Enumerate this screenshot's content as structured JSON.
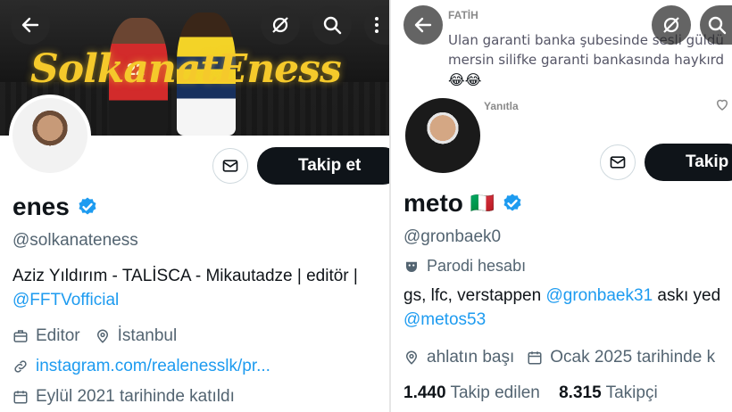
{
  "left_profile": {
    "banner_text": "SolkanatEness",
    "jersey1": "22",
    "display_name": "enes",
    "handle": "@solkanateness",
    "bio_line1": "Aziz Yıldırım - TALİSCA - Mikautadze | editör |",
    "bio_link": "@FFTVofficial",
    "category": "Editor",
    "location": "İstanbul",
    "website": "instagram.com/realenesslk/pr...",
    "joined": "Eylül 2021 tarihinde katıldı",
    "follow_label": "Takip et",
    "icons": [
      "back-arrow-icon",
      "grok-icon",
      "search-icon",
      "more-icon",
      "mail-icon",
      "verified-badge-icon",
      "briefcase-icon",
      "location-pin-icon",
      "link-icon",
      "calendar-icon"
    ]
  },
  "right_profile": {
    "comment_author": "FATİH",
    "comment_text": "Ulan garanti banka şubesinde sesli güldü mersin silifke garanti bankasında haykırd",
    "comment_emoji": "😂😂",
    "reply_label": "Yanıtla",
    "display_name": "meto",
    "flag": "🇮🇹",
    "handle": "@gronbaek0",
    "parody_label": "Parodi hesabı",
    "bio_text": "gs, lfc, verstappen",
    "bio_link1": "@gronbaek31",
    "bio_tail": "askı yed",
    "bio_link2": "@metos53",
    "location": "ahlatın başı",
    "joined": "Ocak 2025 tarihinde k",
    "following_count": "1.440",
    "following_label": "Takip edilen",
    "followers_count": "8.315",
    "followers_label": "Takipçi",
    "follow_label": "Takip",
    "icons": [
      "back-arrow-icon",
      "grok-icon",
      "search-icon",
      "heart-icon",
      "mail-icon",
      "verified-badge-icon",
      "mask-icon",
      "location-pin-icon",
      "calendar-icon"
    ]
  },
  "colors": {
    "verified": "#1d9bf0",
    "link": "#1d9bf0",
    "text_secondary": "#536471",
    "follow_button": "#0f1419",
    "banner_text": "#f5c92b"
  }
}
